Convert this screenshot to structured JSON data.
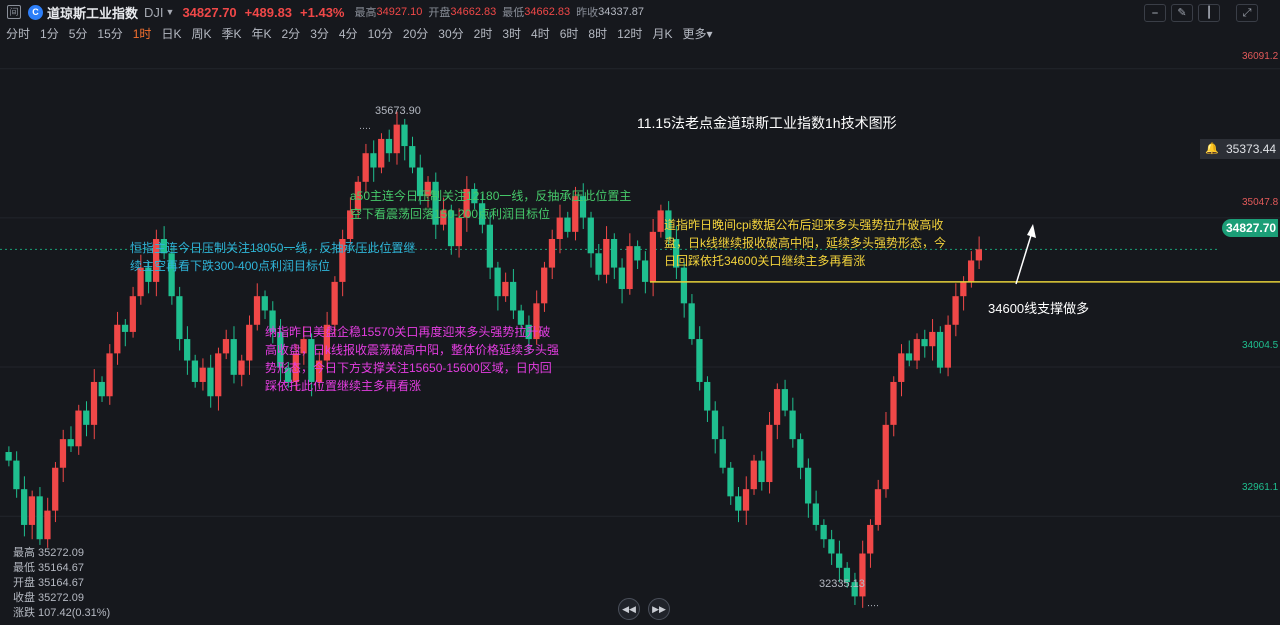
{
  "header": {
    "name": "道琼斯工业指数",
    "code": "DJI",
    "last_price": "34827.70",
    "change": "+489.83",
    "change_pct": "+1.43%",
    "high_label": "最高",
    "high_value": "34927.10",
    "open_label": "开盘",
    "open_value": "34662.83",
    "low_label": "最低",
    "low_value": "34662.83",
    "prev_close_label": "昨收",
    "prev_close_value": "34337.87",
    "logo_letter": "C",
    "icon_glyph": "间"
  },
  "toolbar": {
    "icons": [
      "line-tool-icon",
      "pen-icon",
      "candle-icon",
      "expand-icon"
    ]
  },
  "timeframes": [
    "分时",
    "1分",
    "5分",
    "15分",
    "1时",
    "日K",
    "周K",
    "季K",
    "年K",
    "2分",
    "3分",
    "4分",
    "10分",
    "20分",
    "30分",
    "2时",
    "3时",
    "4时",
    "6时",
    "8时",
    "12时",
    "月K",
    "更多▾"
  ],
  "active_timeframe": "1时",
  "axis": {
    "y_ticks": [
      "36091.2",
      "35047.8",
      "34004.5",
      "32961.1"
    ],
    "current_price": "34827.70",
    "alert_price": "35373.44"
  },
  "annotations": {
    "title": "11.15法老点金道琼斯工业指数1h技术图形",
    "green": "a50主连今日压制关注12180一线，反抽承压此位置主空下看震荡回落150-200点利润目标位",
    "cyan": "恒指主连今日压制关注18050一线，反抽承压此位置继续主空再看下跌300-400点利润目标位",
    "magenta": "纳指昨日美盘企稳15570关口再度迎来多头强势拉升破高收盘，日k线报收震荡破高中阳，整体价格延续多头强势形态，今日下方支撑关注15650-15600区域，日内回踩依托此位置继续主多再看涨",
    "yellow": "道指昨日晚间cpi数据公布后迎来多头强势拉升破高收盘，日k线继续报收破高中阳，延续多头强势形态，今日回踩依托34600关口继续主多再看涨",
    "support": "34600线支撑做多",
    "high_mark": "35673.90",
    "low_mark": "32335.13"
  },
  "stats": {
    "high": "最高 35272.09",
    "low": "最低 35164.67",
    "open": "开盘 35164.67",
    "close": "收盘 35272.09",
    "change": "涨跌 107.42(0.31%)"
  },
  "colors": {
    "up": "#f04848",
    "down": "#1fbf8f",
    "support_line": "#e6d23a",
    "background": "#16181d"
  },
  "chart_data": {
    "type": "candlestick",
    "y_axis_ticks": [
      36091.2,
      35047.8,
      34004.5,
      32961.1
    ],
    "ylim": [
      32200,
      36250
    ],
    "candles_close": [
      33350,
      33150,
      32900,
      33100,
      32800,
      33000,
      33300,
      33500,
      33450,
      33700,
      33600,
      33900,
      33800,
      34100,
      34300,
      34250,
      34500,
      34700,
      34600,
      34900,
      34800,
      34500,
      34200,
      34050,
      33900,
      34000,
      33800,
      34100,
      34200,
      33950,
      34050,
      34300,
      34500,
      34400,
      34250,
      34000,
      33900,
      34100,
      34200,
      33900,
      34050,
      34300,
      34600,
      34900,
      35100,
      35300,
      35500,
      35400,
      35600,
      35500,
      35700,
      35550,
      35400,
      35200,
      35300,
      35000,
      35100,
      34850,
      35050,
      35250,
      35150,
      35000,
      34700,
      34500,
      34600,
      34400,
      34300,
      34200,
      34450,
      34700,
      34900,
      35050,
      34950,
      35200,
      35050,
      34800,
      34650,
      34900,
      34700,
      34550,
      34850,
      34750,
      34600,
      34950,
      35100,
      34900,
      34700,
      34450,
      34200,
      33900,
      33700,
      33500,
      33300,
      33100,
      33000,
      33150,
      33350,
      33200,
      33600,
      33850,
      33700,
      33500,
      33300,
      33050,
      32900,
      32800,
      32700,
      32600,
      32500,
      32400,
      32700,
      32900,
      33150,
      33600,
      33900,
      34100,
      34050,
      34200,
      34150,
      34250,
      34000,
      34300,
      34500,
      34600,
      34750,
      34827.7
    ],
    "high_marker": 35673.9,
    "low_marker": 32335.13,
    "support_level": 34600,
    "current_price": 34827.7
  }
}
